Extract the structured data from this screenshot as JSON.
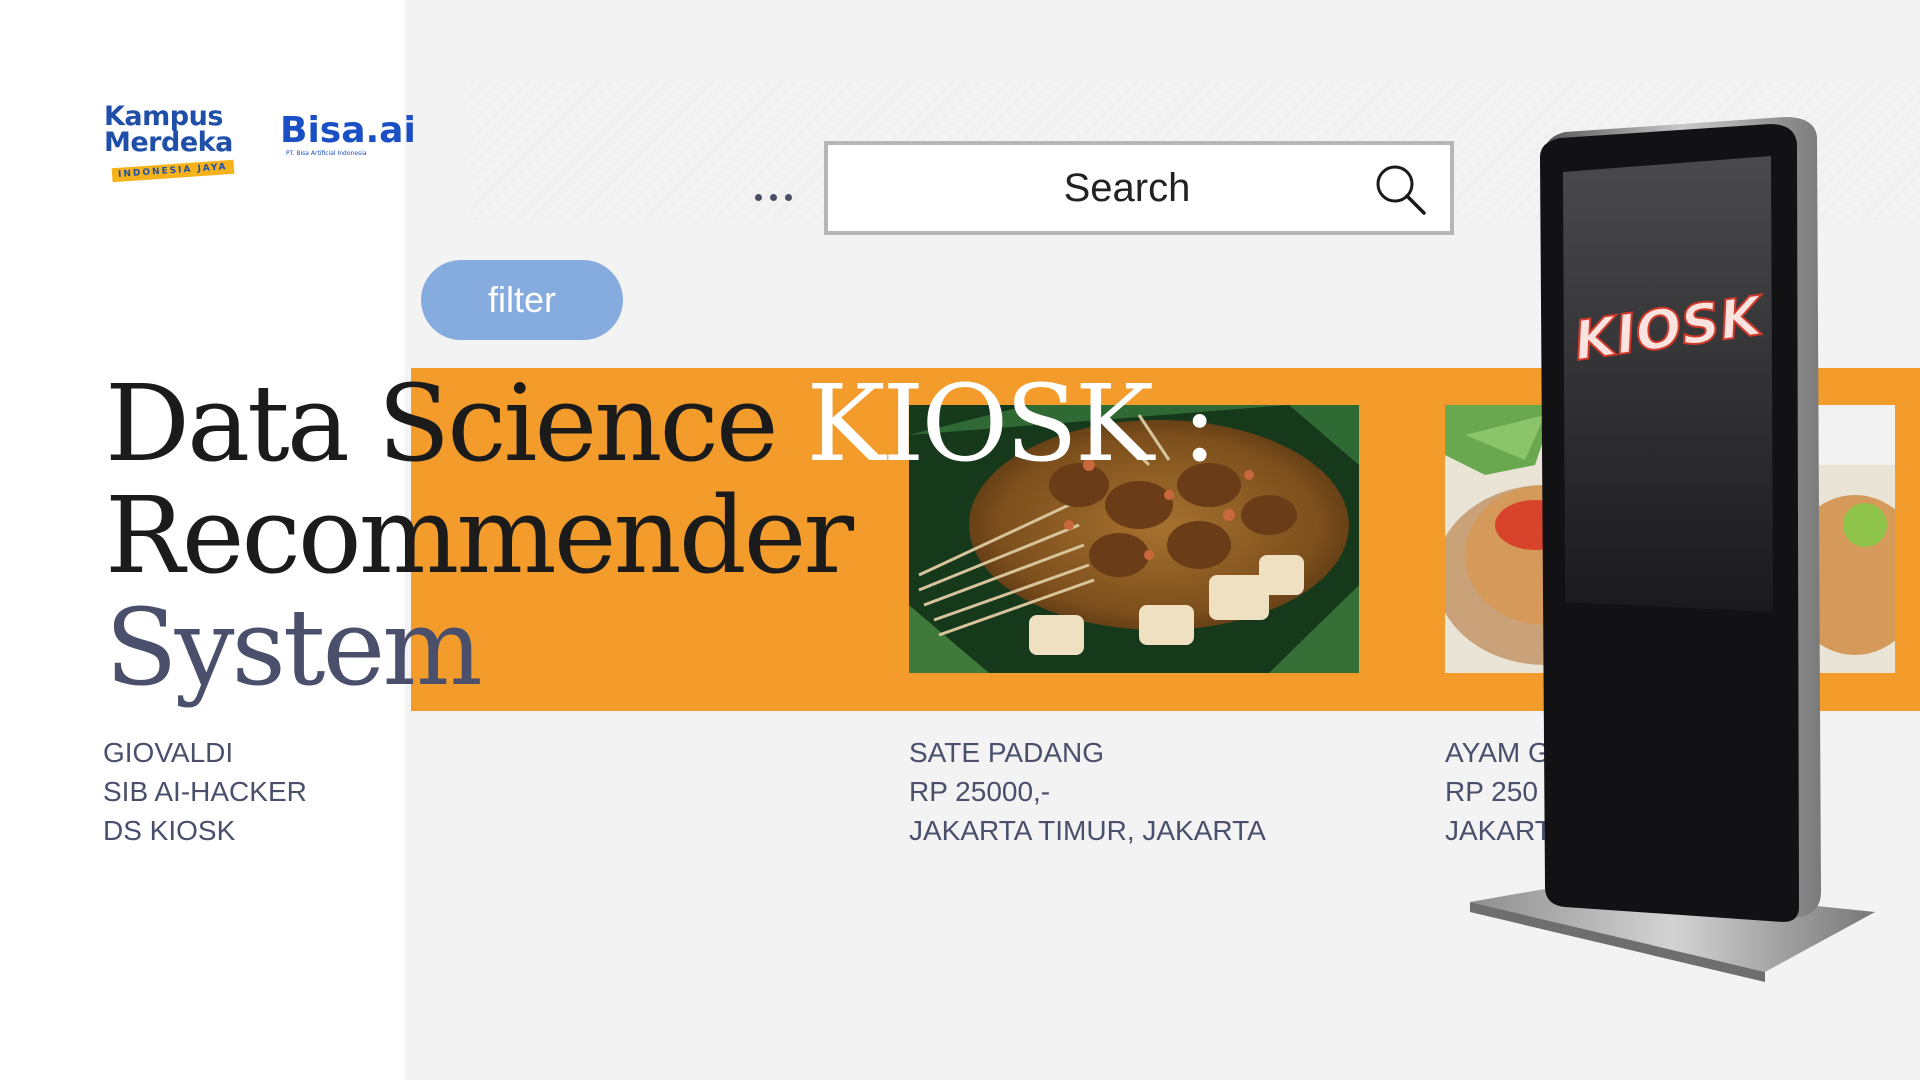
{
  "logos": {
    "kampus_merdeka": {
      "line1": "Kampus",
      "line2": "Merdeka",
      "tagline": "INDONESIA JAYA"
    },
    "bisa_ai": {
      "name": "Bisa.ai",
      "subtitle": "PT. Bisa Artificial Indonesia"
    }
  },
  "toolbar": {
    "more_icon": "more-dots-icon"
  },
  "search": {
    "placeholder": "Search",
    "icon": "search-icon"
  },
  "filter": {
    "label": "filter",
    "color": "#86acdf"
  },
  "title": {
    "line1_part1": "Data Science ",
    "line1_part2": "KIOSK :",
    "line2": "Recommender",
    "line3": "System"
  },
  "author": {
    "name": "GIOVALDI",
    "program": "SIB AI-HACKER",
    "project": "DS KIOSK"
  },
  "foods": [
    {
      "name": "SATE PADANG",
      "price": "RP 25000,-",
      "location": "JAKARTA TIMUR, JAKARTA"
    },
    {
      "name": "AYAM G",
      "price": "RP 250",
      "location": "JAKART"
    }
  ],
  "kiosk_screen_text": "KIOSK",
  "colors": {
    "accent_orange": "#f39c2b",
    "text_dark": "#1b1b1b",
    "text_muted": "#4a4f6c"
  }
}
